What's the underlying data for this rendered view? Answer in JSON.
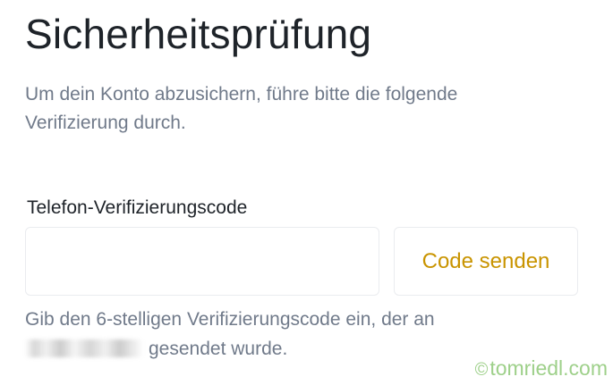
{
  "page": {
    "title": "Sicherheitsprüfung",
    "subtitle": "Um dein Konto abzusichern, führe bitte die folgende Verifizierung durch."
  },
  "verification": {
    "label": "Telefon-Verifizierungscode",
    "input_value": "",
    "send_button_label": "Code senden",
    "helper_text_before": "Gib den 6-stelligen Verifizierungscode ein, der an",
    "helper_text_after": "gesendet wurde."
  },
  "watermark": {
    "symbol": "©",
    "text": "tomriedl.com"
  },
  "colors": {
    "accent": "#c99400",
    "text_primary": "#1e2329",
    "text_secondary": "#707a8a",
    "border": "#eaecef",
    "watermark": "#9ed08a"
  },
  "icons": {
    "watermark_icon": "copyright-icon"
  }
}
